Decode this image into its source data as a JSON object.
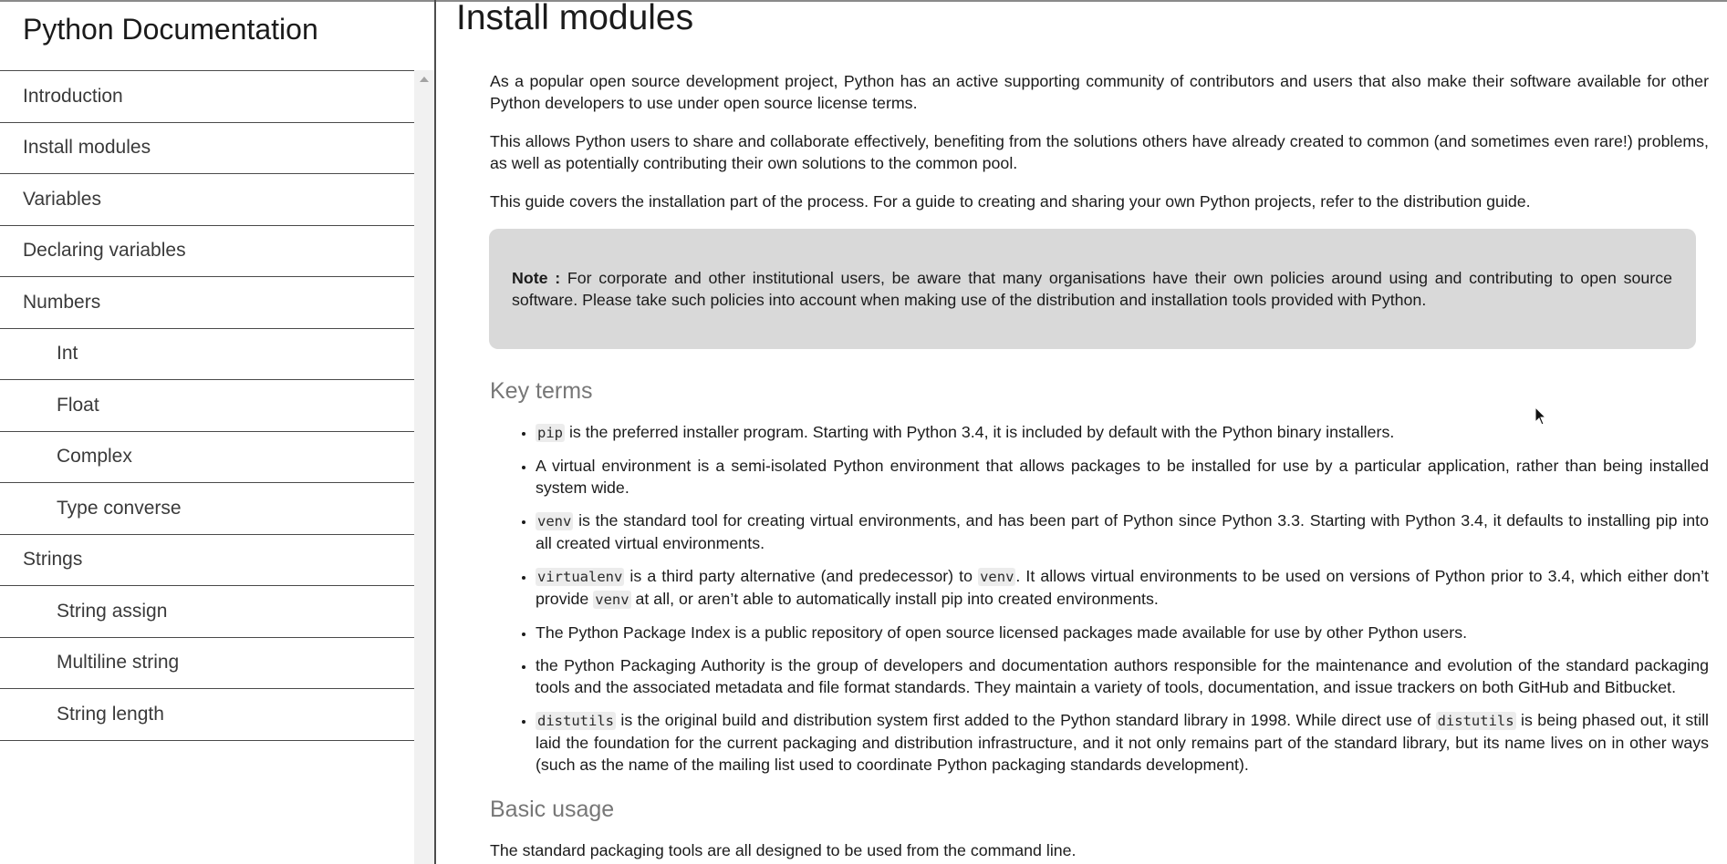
{
  "sidebar": {
    "title": "Python Documentation",
    "items": [
      {
        "label": "Introduction",
        "sub": false
      },
      {
        "label": "Install modules",
        "sub": false
      },
      {
        "label": "Variables",
        "sub": false
      },
      {
        "label": "Declaring variables",
        "sub": false
      },
      {
        "label": "Numbers",
        "sub": false
      },
      {
        "label": "Int",
        "sub": true
      },
      {
        "label": "Float",
        "sub": true
      },
      {
        "label": "Complex",
        "sub": true
      },
      {
        "label": "Type converse",
        "sub": true
      },
      {
        "label": "Strings",
        "sub": false
      },
      {
        "label": "String assign",
        "sub": true
      },
      {
        "label": "Multiline string",
        "sub": true
      },
      {
        "label": "String length",
        "sub": true
      }
    ]
  },
  "main": {
    "title": "Install modules",
    "intro": [
      "As a popular open source development project, Python has an active supporting community of contributors and users that also make their software available for other Python developers to use under open source license terms.",
      "This allows Python users to share and collaborate effectively, benefiting from the solutions others have already created to common (and sometimes even rare!) problems, as well as potentially contributing their own solutions to the common pool.",
      "This guide covers the installation part of the process. For a guide to creating and sharing your own Python projects, refer to the distribution guide."
    ],
    "note": {
      "label": "Note :",
      "text": " For corporate and other institutional users, be aware that many organisations have their own policies around using and contributing to open source software. Please take such policies into account when making use of the distribution and installation tools provided with Python."
    },
    "key_terms": {
      "heading": "Key terms",
      "items": [
        [
          {
            "code": "pip"
          },
          {
            "text": " is the preferred installer program. Starting with Python 3.4, it is included by default with the Python binary installers."
          }
        ],
        [
          {
            "text": "A virtual environment is a semi-isolated Python environment that allows packages to be installed for use by a particular application, rather than being installed system wide."
          }
        ],
        [
          {
            "code": "venv"
          },
          {
            "text": " is the standard tool for creating virtual environments, and has been part of Python since Python 3.3. Starting with Python 3.4, it defaults to installing pip into all created virtual environments."
          }
        ],
        [
          {
            "code": "virtualenv"
          },
          {
            "text": " is a third party alternative (and predecessor) to "
          },
          {
            "code": "venv"
          },
          {
            "text": ". It allows virtual environments to be used on versions of Python prior to 3.4, which either don’t provide "
          },
          {
            "code": "venv"
          },
          {
            "text": " at all, or aren’t able to automatically install pip into created environments."
          }
        ],
        [
          {
            "text": "The Python Package Index is a public repository of open source licensed packages made available for use by other Python users."
          }
        ],
        [
          {
            "text": "the Python Packaging Authority is the group of developers and documentation authors responsible for the maintenance and evolution of the standard packaging tools and the associated metadata and file format standards. They maintain a variety of tools, documentation, and issue trackers on both GitHub and Bitbucket."
          }
        ],
        [
          {
            "code": "distutils"
          },
          {
            "text": " is the original build and distribution system first added to the Python standard library in 1998. While direct use of "
          },
          {
            "code": "distutils"
          },
          {
            "text": " is being phased out, it still laid the foundation for the current packaging and distribution infrastructure, and it not only remains part of the standard library, but its name lives on in other ways (such as the name of the mailing list used to coordinate Python packaging standards development)."
          }
        ]
      ]
    },
    "basic_usage": {
      "heading": "Basic usage",
      "text": "The standard packaging tools are all designed to be used from the command line."
    }
  }
}
